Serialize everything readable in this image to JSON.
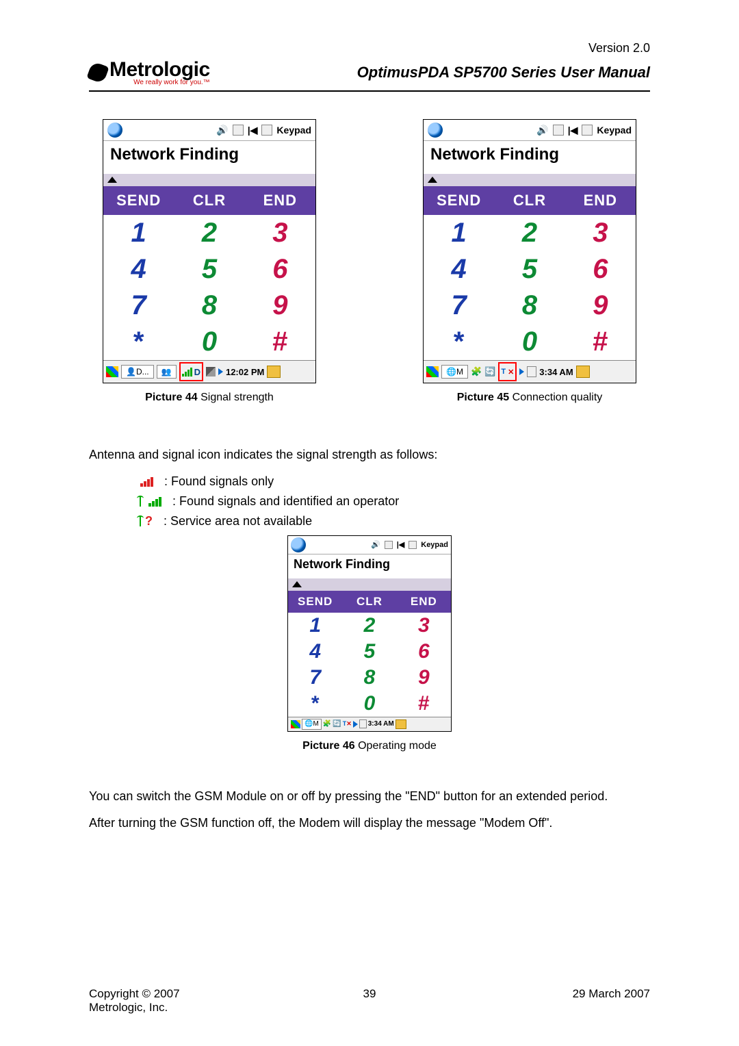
{
  "version_label": "Version 2.0",
  "logo_text": "Metrologic",
  "logo_tag": "We really work for you.™",
  "doc_title": "OptimusPDA SP5700 Series User Manual",
  "screenshot": {
    "top_label": "Keypad",
    "title": "Network Finding",
    "buttons": {
      "send": "SEND",
      "clr": "CLR",
      "end": "END"
    },
    "keys_row1": [
      "1",
      "2",
      "3"
    ],
    "keys_row2": [
      "4",
      "5",
      "6"
    ],
    "keys_row3": [
      "7",
      "8",
      "9"
    ],
    "keys_row4": [
      "*",
      "0",
      "#"
    ]
  },
  "taskbar_a": {
    "app": "D...",
    "time": "12:02 PM"
  },
  "taskbar_b": {
    "app": "M",
    "time": "3:34 AM"
  },
  "captions": {
    "p44_bold": "Picture 44 ",
    "p44_text": "Signal strength",
    "p45_bold": "Picture 45 ",
    "p45_text": "Connection quality",
    "p46_bold": "Picture 46 ",
    "p46_text": "Operating mode"
  },
  "body": {
    "intro": "Antenna and signal icon indicates the signal strength as follows:",
    "b1": ": Found signals only",
    "b2": ": Found signals and identified an operator",
    "b3": ": Service area not available",
    "gsm1": "You can switch the GSM Module on or off by pressing the \"END\" button for an extended period.",
    "gsm2": "After turning the GSM function off, the Modem will display the message \"Modem Off\"."
  },
  "footer": {
    "copyright_line1": "Copyright © 2007",
    "copyright_line2": "Metrologic, Inc.",
    "page_num": "39",
    "date": "29 March 2007"
  }
}
